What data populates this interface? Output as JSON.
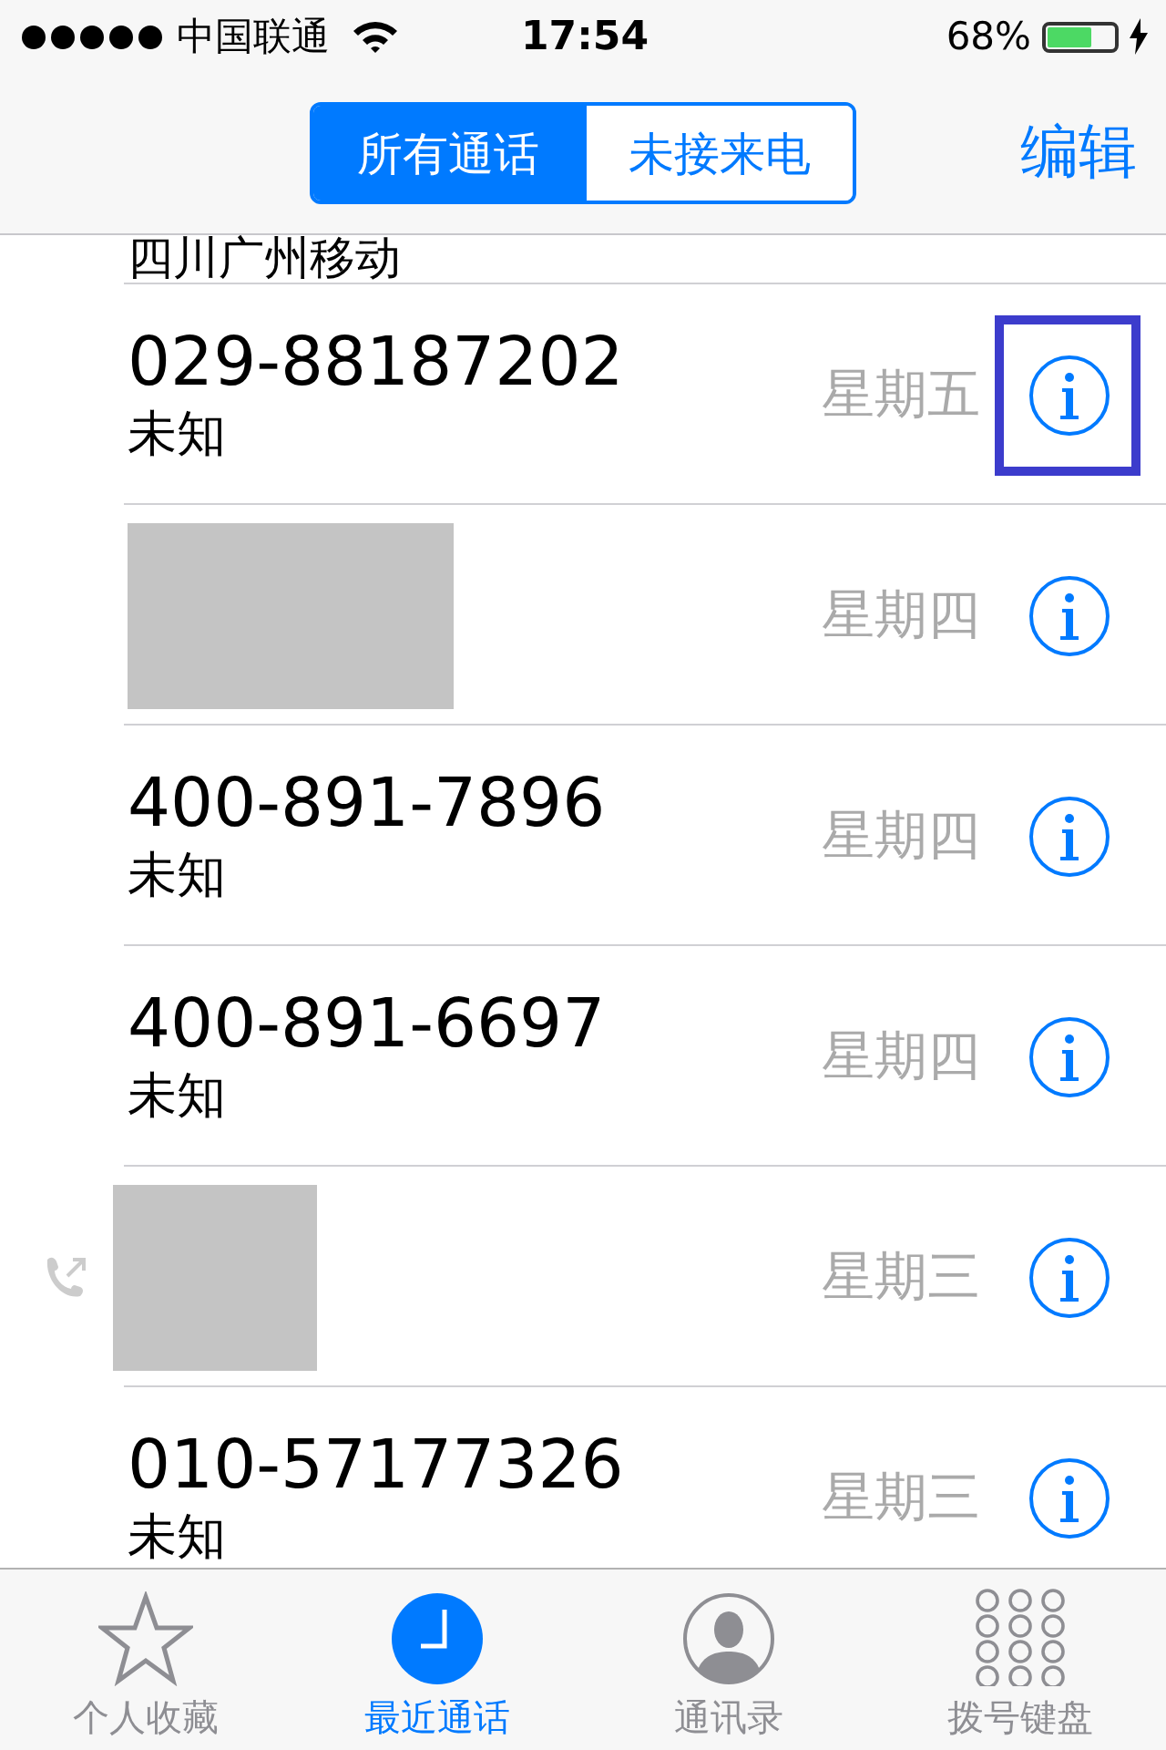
{
  "status_bar": {
    "carrier": "中国联通",
    "time": "17:54",
    "battery_text": "68%",
    "battery": {
      "level": 0.68,
      "charging": true
    }
  },
  "segments": [
    {
      "label": "所有通话",
      "selected": true
    },
    {
      "label": "未接来电",
      "selected": false
    }
  ],
  "edit_button": "编辑",
  "calls": [
    {
      "kind": "number",
      "subtitle": "四川广州移动",
      "partial": true
    },
    {
      "kind": "number",
      "number": "029-88187202",
      "subtitle": "未知",
      "day": "星期五",
      "highlighted": true
    },
    {
      "kind": "redacted",
      "day": "星期四"
    },
    {
      "kind": "number",
      "number": "400-891-7896",
      "subtitle": "未知",
      "day": "星期四"
    },
    {
      "kind": "number",
      "number": "400-891-6697",
      "subtitle": "未知",
      "day": "星期四"
    },
    {
      "kind": "redacted",
      "day": "星期三",
      "outgoing": true
    },
    {
      "kind": "number",
      "number": "010-57177326",
      "subtitle": "未知",
      "day": "星期三"
    }
  ],
  "tab_bar": [
    {
      "label": "个人收藏",
      "selected": false
    },
    {
      "label": "最近通话",
      "selected": true
    },
    {
      "label": "通讯录",
      "selected": false
    },
    {
      "label": "拨号键盘",
      "selected": false
    }
  ]
}
